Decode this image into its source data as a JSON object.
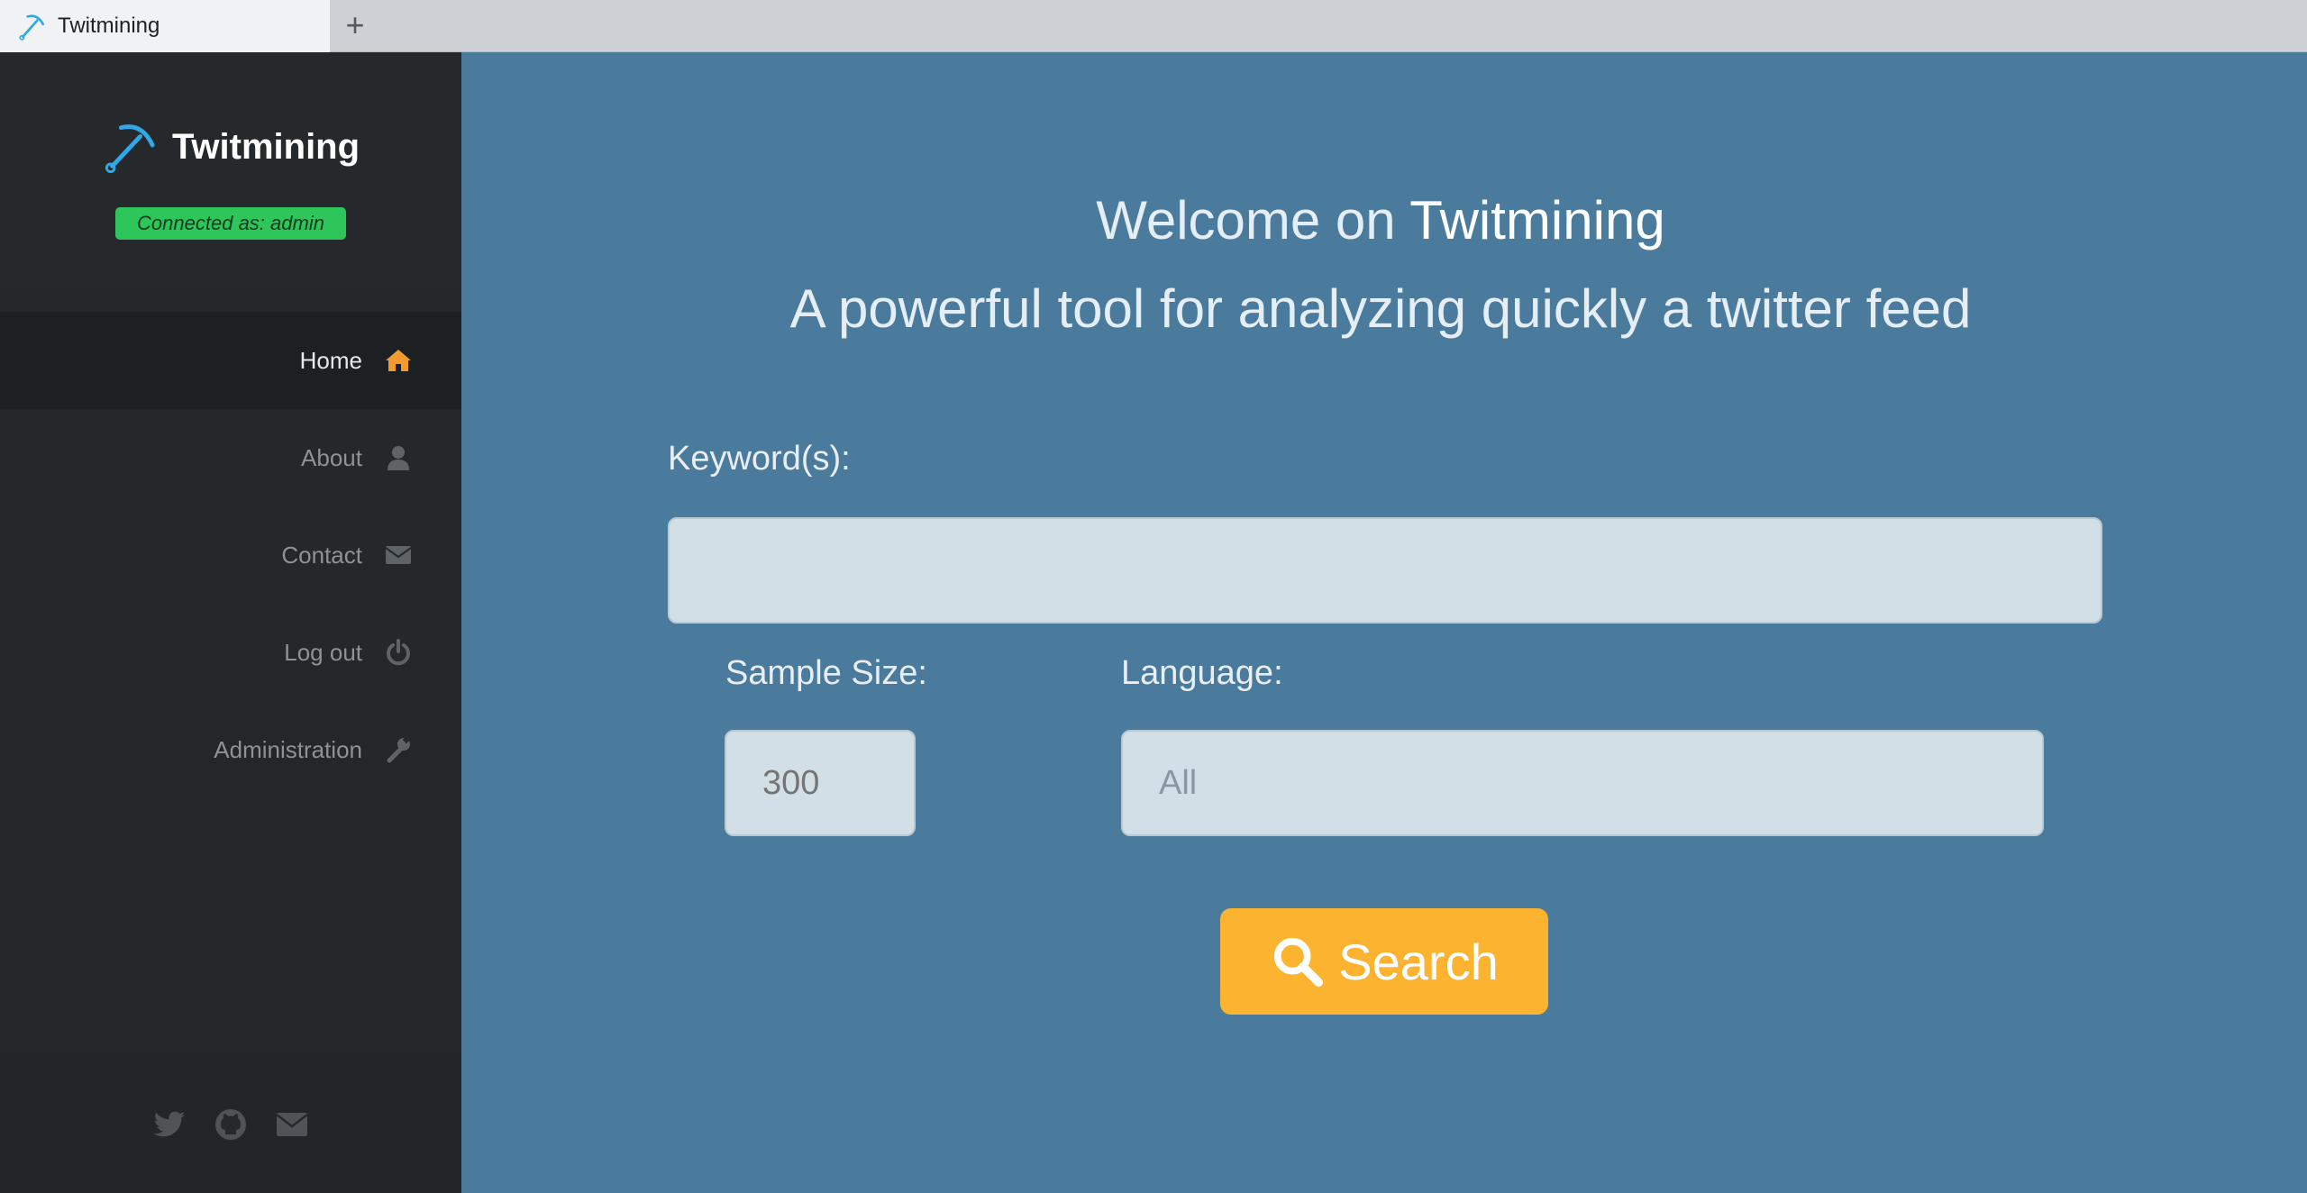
{
  "browser": {
    "tab_title": "Twitmining",
    "new_tab_label": "+"
  },
  "sidebar": {
    "brand": "Twitmining",
    "connected_badge": "Connected as: admin",
    "nav": [
      {
        "label": "Home",
        "icon": "home-icon",
        "active": true
      },
      {
        "label": "About",
        "icon": "user-icon",
        "active": false
      },
      {
        "label": "Contact",
        "icon": "envelope-icon",
        "active": false
      },
      {
        "label": "Log out",
        "icon": "power-icon",
        "active": false
      },
      {
        "label": "Administration",
        "icon": "wrench-icon",
        "active": false
      }
    ],
    "social": [
      "twitter-icon",
      "github-icon",
      "envelope-icon"
    ]
  },
  "main": {
    "welcome_prefix": "Welcome on",
    "welcome_brand": "Twitmining",
    "tagline": "A powerful tool for analyzing quickly a twitter feed",
    "keyword_label": "Keyword(s):",
    "keyword_value": "",
    "sample_label": "Sample Size:",
    "sample_placeholder": "300",
    "language_label": "Language:",
    "language_selected": "All",
    "search_label": "Search"
  },
  "colors": {
    "main_bg": "#4a7b9d",
    "sidebar_bg": "#26292c",
    "badge_green": "#2ec55a",
    "accent_orange": "#fbb330",
    "brand_blue": "#2fa8e8"
  }
}
